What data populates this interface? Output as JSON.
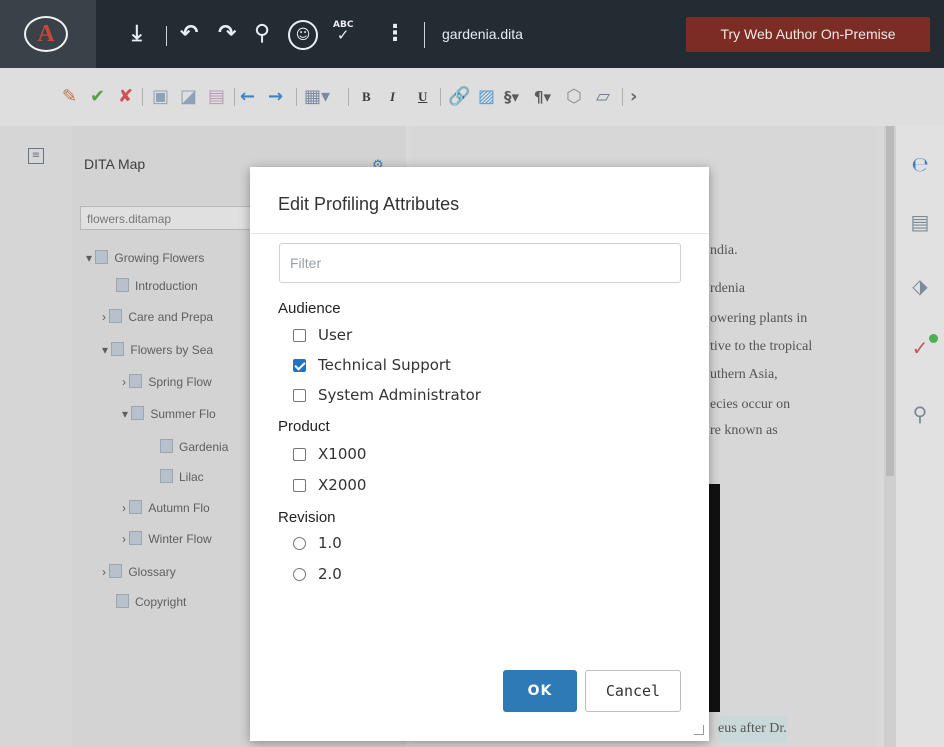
{
  "topbar": {
    "logo_letter": "A",
    "filename": "gardenia.dita",
    "try_button": "Try Web Author On-Premise",
    "icons": [
      "download-icon",
      "undo-icon",
      "redo-icon",
      "search-icon",
      "accessibility-icon",
      "spellcheck-icon",
      "more-vertical-icon"
    ],
    "spell_abc": "ABC",
    "colors": {
      "background": "#232b33",
      "try_button": "#7b2d25",
      "logo": "#c14a38"
    }
  },
  "map_panel": {
    "title": "DITA Map",
    "map_select": "flowers.ditamap",
    "tree": [
      "Growing Flowers",
      "Introduction",
      "Care and Prepa",
      "Flowers by Sea",
      "Spring Flow",
      "Summer Flo",
      "Gardenia",
      "Lilac",
      "Autumn Flo",
      "Winter Flow",
      "Glossary",
      "Copyright"
    ]
  },
  "editor": {
    "lines": [
      "ndia.",
      "rdenia",
      "owering plants in",
      "tive to the tropical",
      "uthern Asia,",
      "ecies occur on",
      "re known as"
    ],
    "footer_text": "eus after Dr."
  },
  "dialog": {
    "title": "Edit Profiling Attributes",
    "filter_placeholder": "Filter",
    "groups": [
      {
        "label": "Audience",
        "options": [
          {
            "label": "User",
            "checked": false
          },
          {
            "label": "Technical Support",
            "checked": true
          },
          {
            "label": "System Administrator",
            "checked": false
          }
        ]
      },
      {
        "label": "Product",
        "options": [
          {
            "label": "X1000",
            "checked": false
          },
          {
            "label": "X2000",
            "checked": false
          }
        ]
      },
      {
        "label": "Revision",
        "options": [
          {
            "label": "1.0",
            "selected": false
          },
          {
            "label": "2.0",
            "selected": false
          }
        ]
      }
    ],
    "ok_label": "OK",
    "cancel_label": "Cancel",
    "accent": "#2e7ab6"
  }
}
